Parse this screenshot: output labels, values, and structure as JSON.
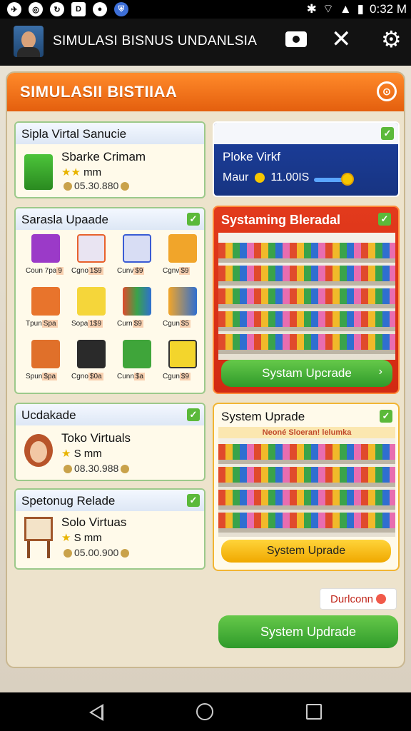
{
  "status": {
    "icons": [
      "nav-icon",
      "badge-icon",
      "share-icon",
      "doc-icon",
      "droplet-icon",
      "shield-icon"
    ],
    "time": "0:32 M"
  },
  "appbar": {
    "title": "SIMULASI BISNUS UNDANLSIA"
  },
  "panel": {
    "title": "SIMULASII BISTIIAA"
  },
  "card1": {
    "header": "Sipla Virtal Sanucie",
    "name": "Sbarke Crimam",
    "stars_text": "mm",
    "price": "05.30.880"
  },
  "card2": {
    "title": "Ploke Virkf",
    "label": "Maur",
    "value": "11.00IS"
  },
  "grid": {
    "header": "Sarasla Upaade",
    "items": [
      {
        "label": "Coun 7pa",
        "tag": "9"
      },
      {
        "label": "Cgno",
        "tag": "1$9"
      },
      {
        "label": "Cunv",
        "tag": "$9"
      },
      {
        "label": "Cgnv",
        "tag": "$9"
      },
      {
        "label": "Tpun",
        "tag": "Spa"
      },
      {
        "label": "Sopa",
        "tag": "1$9"
      },
      {
        "label": "Curn",
        "tag": "$9"
      },
      {
        "label": "Cgun",
        "tag": "$5"
      },
      {
        "label": "Spun",
        "tag": "$pa"
      },
      {
        "label": "Cgno",
        "tag": "$0a"
      },
      {
        "label": "Cunn",
        "tag": "$a"
      },
      {
        "label": "Cgun",
        "tag": "$9"
      }
    ]
  },
  "system_card": {
    "title": "Systaming Bleradal",
    "button": "Systam Upcrade"
  },
  "card3": {
    "header": "Ucdakade",
    "name": "Toko Virtuals",
    "stars_text": "S  mm",
    "price": "08.30.988"
  },
  "upgrade_card": {
    "title": "System Uprade",
    "subtitle": "Neoné Sloeran! lelumka",
    "button": "System Uprade"
  },
  "card4": {
    "header": "Spetonug Relade",
    "name": "Solo Virtuas",
    "stars_text": "S  mm",
    "price": "05.00.900"
  },
  "duration": "Durlconn",
  "main_button": "System Updrade",
  "colors": {
    "header_orange": "#e9680f",
    "green": "#3fa732",
    "blue": "#1c3f9e",
    "yellow": "#f6b60a"
  }
}
